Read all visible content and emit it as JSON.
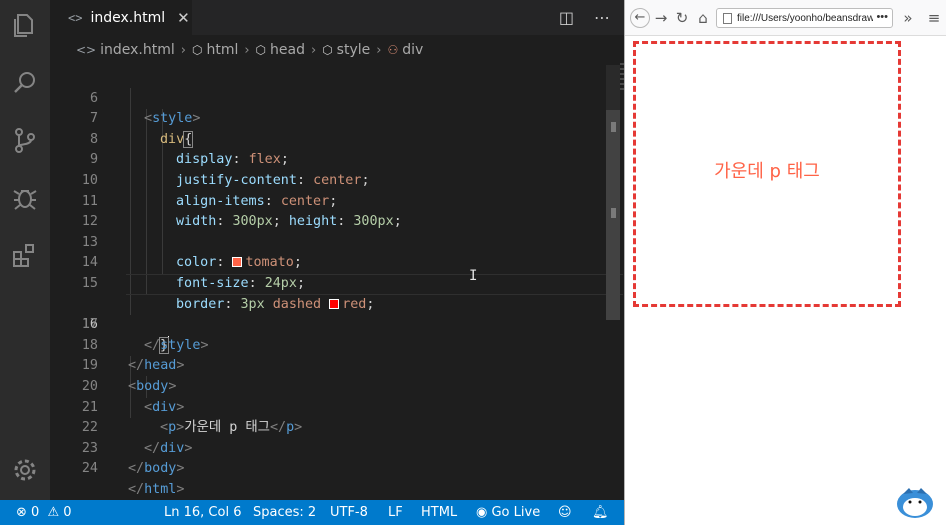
{
  "editor": {
    "tab": {
      "label": "index.html",
      "icon": "code-brackets-icon"
    },
    "breadcrumb": [
      "index.html",
      "html",
      "head",
      "style",
      "div"
    ],
    "lines": [
      {
        "n": "6"
      },
      {
        "n": "7"
      },
      {
        "n": "8"
      },
      {
        "n": "9"
      },
      {
        "n": "10"
      },
      {
        "n": "11"
      },
      {
        "n": "12"
      },
      {
        "n": "13"
      },
      {
        "n": "14"
      },
      {
        "n": "15"
      },
      {
        "n": "16"
      },
      {
        "n": "17"
      },
      {
        "n": "18"
      },
      {
        "n": "19"
      },
      {
        "n": "20"
      },
      {
        "n": "21"
      },
      {
        "n": "22"
      },
      {
        "n": "23"
      },
      {
        "n": "24"
      }
    ],
    "code": {
      "style_open": "style",
      "div_sel": "div",
      "display_prop": "display",
      "display_val": "flex",
      "justify_prop": "justify-content",
      "justify_val": "center",
      "align_prop": "align-items",
      "align_val": "center",
      "width_prop": "width",
      "width_val": "300px",
      "height_prop": "height",
      "height_val": "300px",
      "color_prop": "color",
      "color_val": "tomato",
      "fontsize_prop": "font-size",
      "fontsize_val": "24px",
      "border_prop": "border",
      "border_val_num": "3px",
      "border_val_style": "dashed",
      "border_val_color": "red",
      "style_close": "style",
      "head_close": "head",
      "body_open": "body",
      "div_open": "div",
      "p_open": "p",
      "p_text": "가운데 p 태그",
      "p_close": "p",
      "div_close": "div",
      "body_close": "body",
      "html_close": "html"
    },
    "swatch_colors": {
      "tomato": "#ff6347",
      "red": "#ff0000"
    }
  },
  "statusbar": {
    "errors": "0",
    "warnings": "0",
    "position": "Ln 16, Col 6",
    "spaces": "Spaces: 2",
    "encoding": "UTF-8",
    "eol": "LF",
    "language": "HTML",
    "golive": "Go Live"
  },
  "browser": {
    "url": "file:///Users/yoonho/beansdrawe",
    "content_text": "가운데 p 태그",
    "accent": "#ff6347",
    "border_color": "#e53935"
  }
}
